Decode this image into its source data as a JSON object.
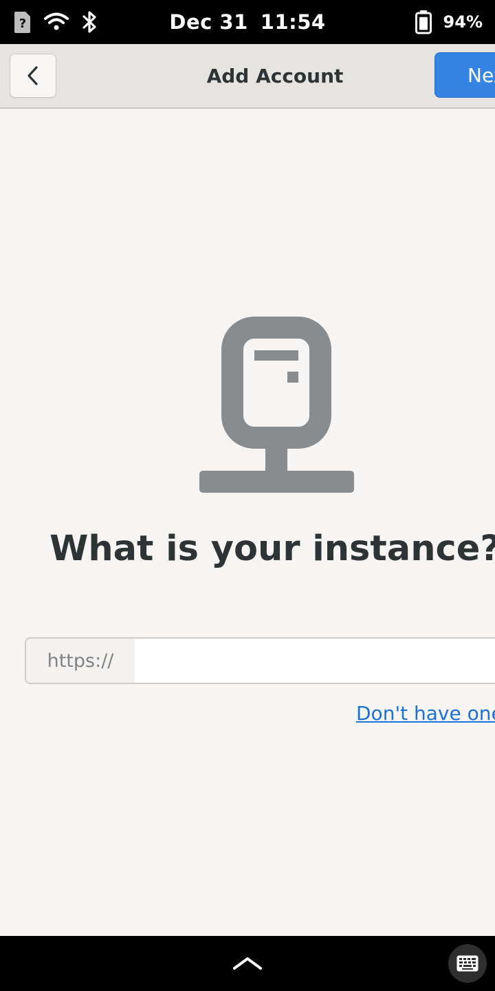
{
  "status_bar": {
    "date": "Dec 31",
    "time": "11:54",
    "battery_percent": "94%",
    "battery_level": 0.94,
    "icons": [
      "sim-unknown-icon",
      "wifi-icon",
      "bluetooth-icon",
      "battery-icon"
    ]
  },
  "header": {
    "title": "Add Account",
    "back_icon": "chevron-left-icon",
    "next_label": "Next"
  },
  "main": {
    "illustration_icon": "server-icon",
    "heading": "What is your instance?",
    "url_prefix": "https://",
    "url_value": "",
    "signup_link": "Don't have one yet?"
  },
  "bottom_bar": {
    "handle_icon": "chevron-up-icon",
    "keyboard_icon": "keyboard-icon"
  },
  "colors": {
    "accent": "#3584e4",
    "link": "#1c71d8",
    "text": "#2e3436",
    "icon_gray": "#898c8e",
    "background": "#f6f5f4",
    "headerbar": "#e6e4e1"
  }
}
